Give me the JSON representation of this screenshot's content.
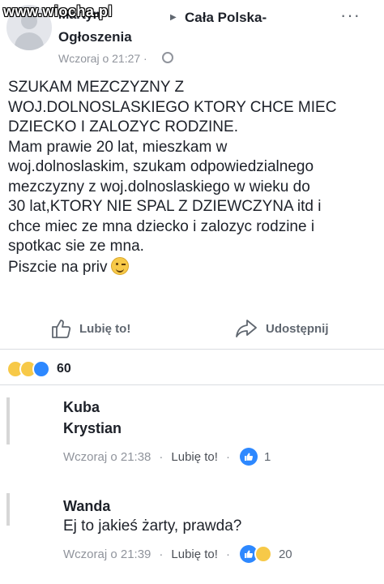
{
  "watermark": "www.wiocha.pl",
  "post": {
    "author": "Martyn",
    "group_line1": "Cała Polska-",
    "group_line2": "Ogłoszenia",
    "time": "Wczoraj o 21:27 ·",
    "more": "···",
    "body_lines": [
      "SZUKAM MEZCZYZNY Z",
      "WOJ.DOLNOSLASKIEGO KTORY CHCE MIEC",
      "DZIECKO I ZALOZYC RODZINE.",
      "Mam prawie 20 lat, mieszkam w",
      "woj.dolnoslaskim, szukam odpowiedzialnego",
      "mezczyzny z woj.dolnoslaskiego w wieku do",
      "30 lat,KTORY NIE SPAL Z DZIEWCZYNA itd i",
      "chce miec ze mna dziecko i zalozyc rodzine i",
      "spotkac sie ze mna.",
      "Piszcie na priv"
    ]
  },
  "actions": {
    "like": "Lubię to!",
    "share": "Udostępnij"
  },
  "reactions": {
    "count": "60"
  },
  "comments": [
    {
      "name_line1": "Kuba",
      "name_line2": "Krystian",
      "time": "Wczoraj o 21:38",
      "like_label": "Lubię to!",
      "reaction_count": "1"
    },
    {
      "name": "Wanda",
      "text": "Ej to jakieś żarty, prawda?",
      "time": "Wczoraj o 21:39",
      "like_label": "Lubię to!",
      "reaction_count": "20"
    }
  ],
  "colors": {
    "text": "#1d2129",
    "muted": "#90949c",
    "like_blue": "#2d88ff",
    "emoji_yellow": "#f7c948"
  }
}
